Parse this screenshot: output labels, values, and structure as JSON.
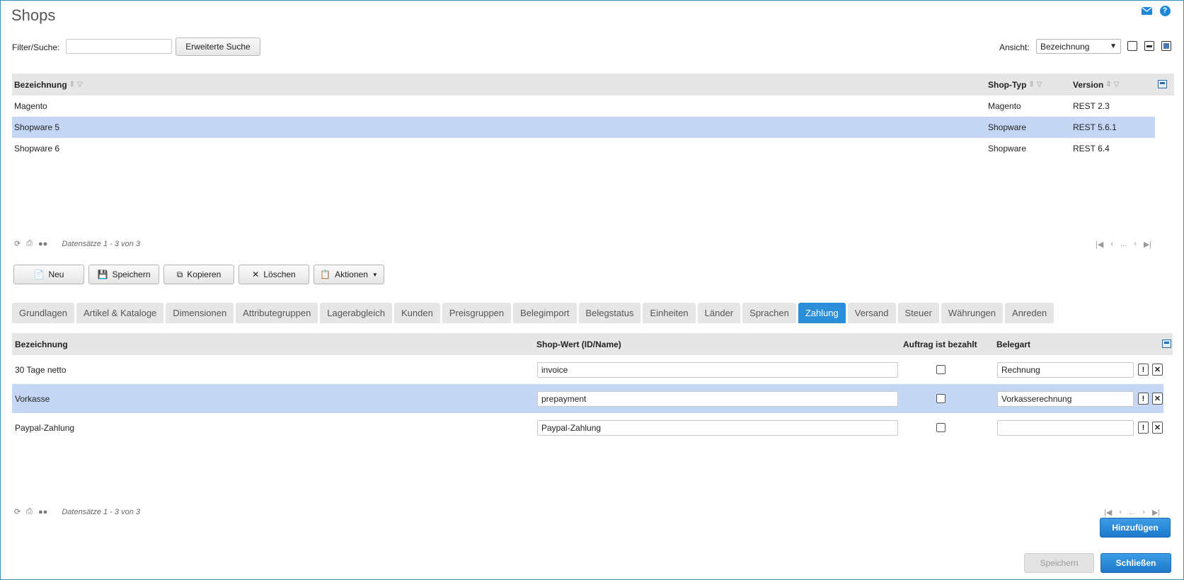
{
  "page": {
    "title": "Shops"
  },
  "filter": {
    "label": "Filter/Suche:",
    "value": "",
    "advanced_label": "Erweiterte Suche",
    "view_label": "Ansicht:",
    "view_selected": "Bezeichnung"
  },
  "grid1": {
    "columns": [
      "Bezeichnung",
      "Shop-Typ",
      "Version"
    ],
    "rows": [
      {
        "name": "Magento",
        "type": "Magento",
        "version": "REST 2.3"
      },
      {
        "name": "Shopware 5",
        "type": "Shopware",
        "version": "REST 5.6.1"
      },
      {
        "name": "Shopware 6",
        "type": "Shopware",
        "version": "REST 6.4"
      }
    ],
    "record_count": "Datensätze 1 - 3 von 3"
  },
  "toolbar": {
    "new": "Neu",
    "save": "Speichern",
    "copy": "Kopieren",
    "delete": "Löschen",
    "actions": "Aktionen"
  },
  "tabs": [
    "Grundlagen",
    "Artikel & Kataloge",
    "Dimensionen",
    "Attributegruppen",
    "Lagerabgleich",
    "Kunden",
    "Preisgruppen",
    "Belegimport",
    "Belegstatus",
    "Einheiten",
    "Länder",
    "Sprachen",
    "Zahlung",
    "Versand",
    "Steuer",
    "Währungen",
    "Anreden"
  ],
  "active_tab": "Zahlung",
  "grid2": {
    "columns": [
      "Bezeichnung",
      "Shop-Wert (ID/Name)",
      "Auftrag ist bezahlt",
      "Belegart"
    ],
    "rows": [
      {
        "name": "30 Tage netto",
        "shop_value": "invoice",
        "paid": false,
        "doc_type": "Rechnung"
      },
      {
        "name": "Vorkasse",
        "shop_value": "prepayment",
        "paid": false,
        "doc_type": "Vorkasserechnung"
      },
      {
        "name": "Paypal-Zahlung",
        "shop_value": "Paypal-Zahlung",
        "paid": false,
        "doc_type": ""
      }
    ],
    "record_count": "Datensätze 1 - 3 von 3"
  },
  "buttons": {
    "add": "Hinzufügen",
    "save": "Speichern",
    "close": "Schließen"
  },
  "colors": {
    "accent": "#2a8fd8",
    "selected_row": "#c5d7f5",
    "header_bg": "#e6e6e6"
  }
}
